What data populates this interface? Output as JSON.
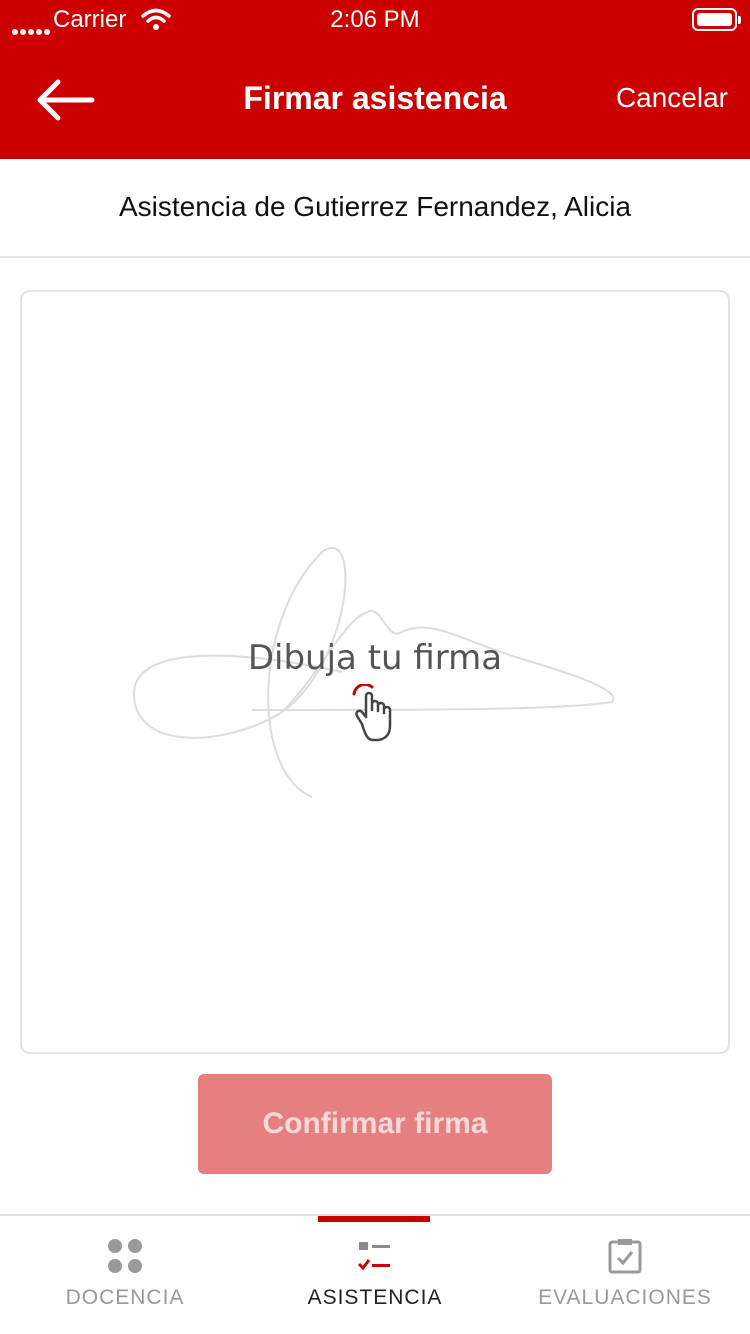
{
  "status_bar": {
    "carrier": "Carrier",
    "time": "2:06 PM"
  },
  "nav": {
    "back_icon": "arrow-left-icon",
    "title": "Firmar asistencia",
    "cancel_label": "Cancelar"
  },
  "subheader": {
    "text": "Asistencia de Gutierrez Fernandez, Alicia"
  },
  "signature_pad": {
    "placeholder": "Dibuja tu firma",
    "hint_icon": "hand-pointer-icon"
  },
  "confirm_button": {
    "label": "Confirmar firma",
    "state": "disabled"
  },
  "tabbar": {
    "items": [
      {
        "label": "DOCENCIA",
        "icon": "grid-dots-icon",
        "active": false
      },
      {
        "label": "ASISTENCIA",
        "icon": "checklist-icon",
        "active": true
      },
      {
        "label": "EVALUACIONES",
        "icon": "clipboard-check-icon",
        "active": false
      }
    ]
  },
  "colors": {
    "brand_red": "#cc0000",
    "button_disabled": "#e68080",
    "tab_inactive": "#999999"
  }
}
